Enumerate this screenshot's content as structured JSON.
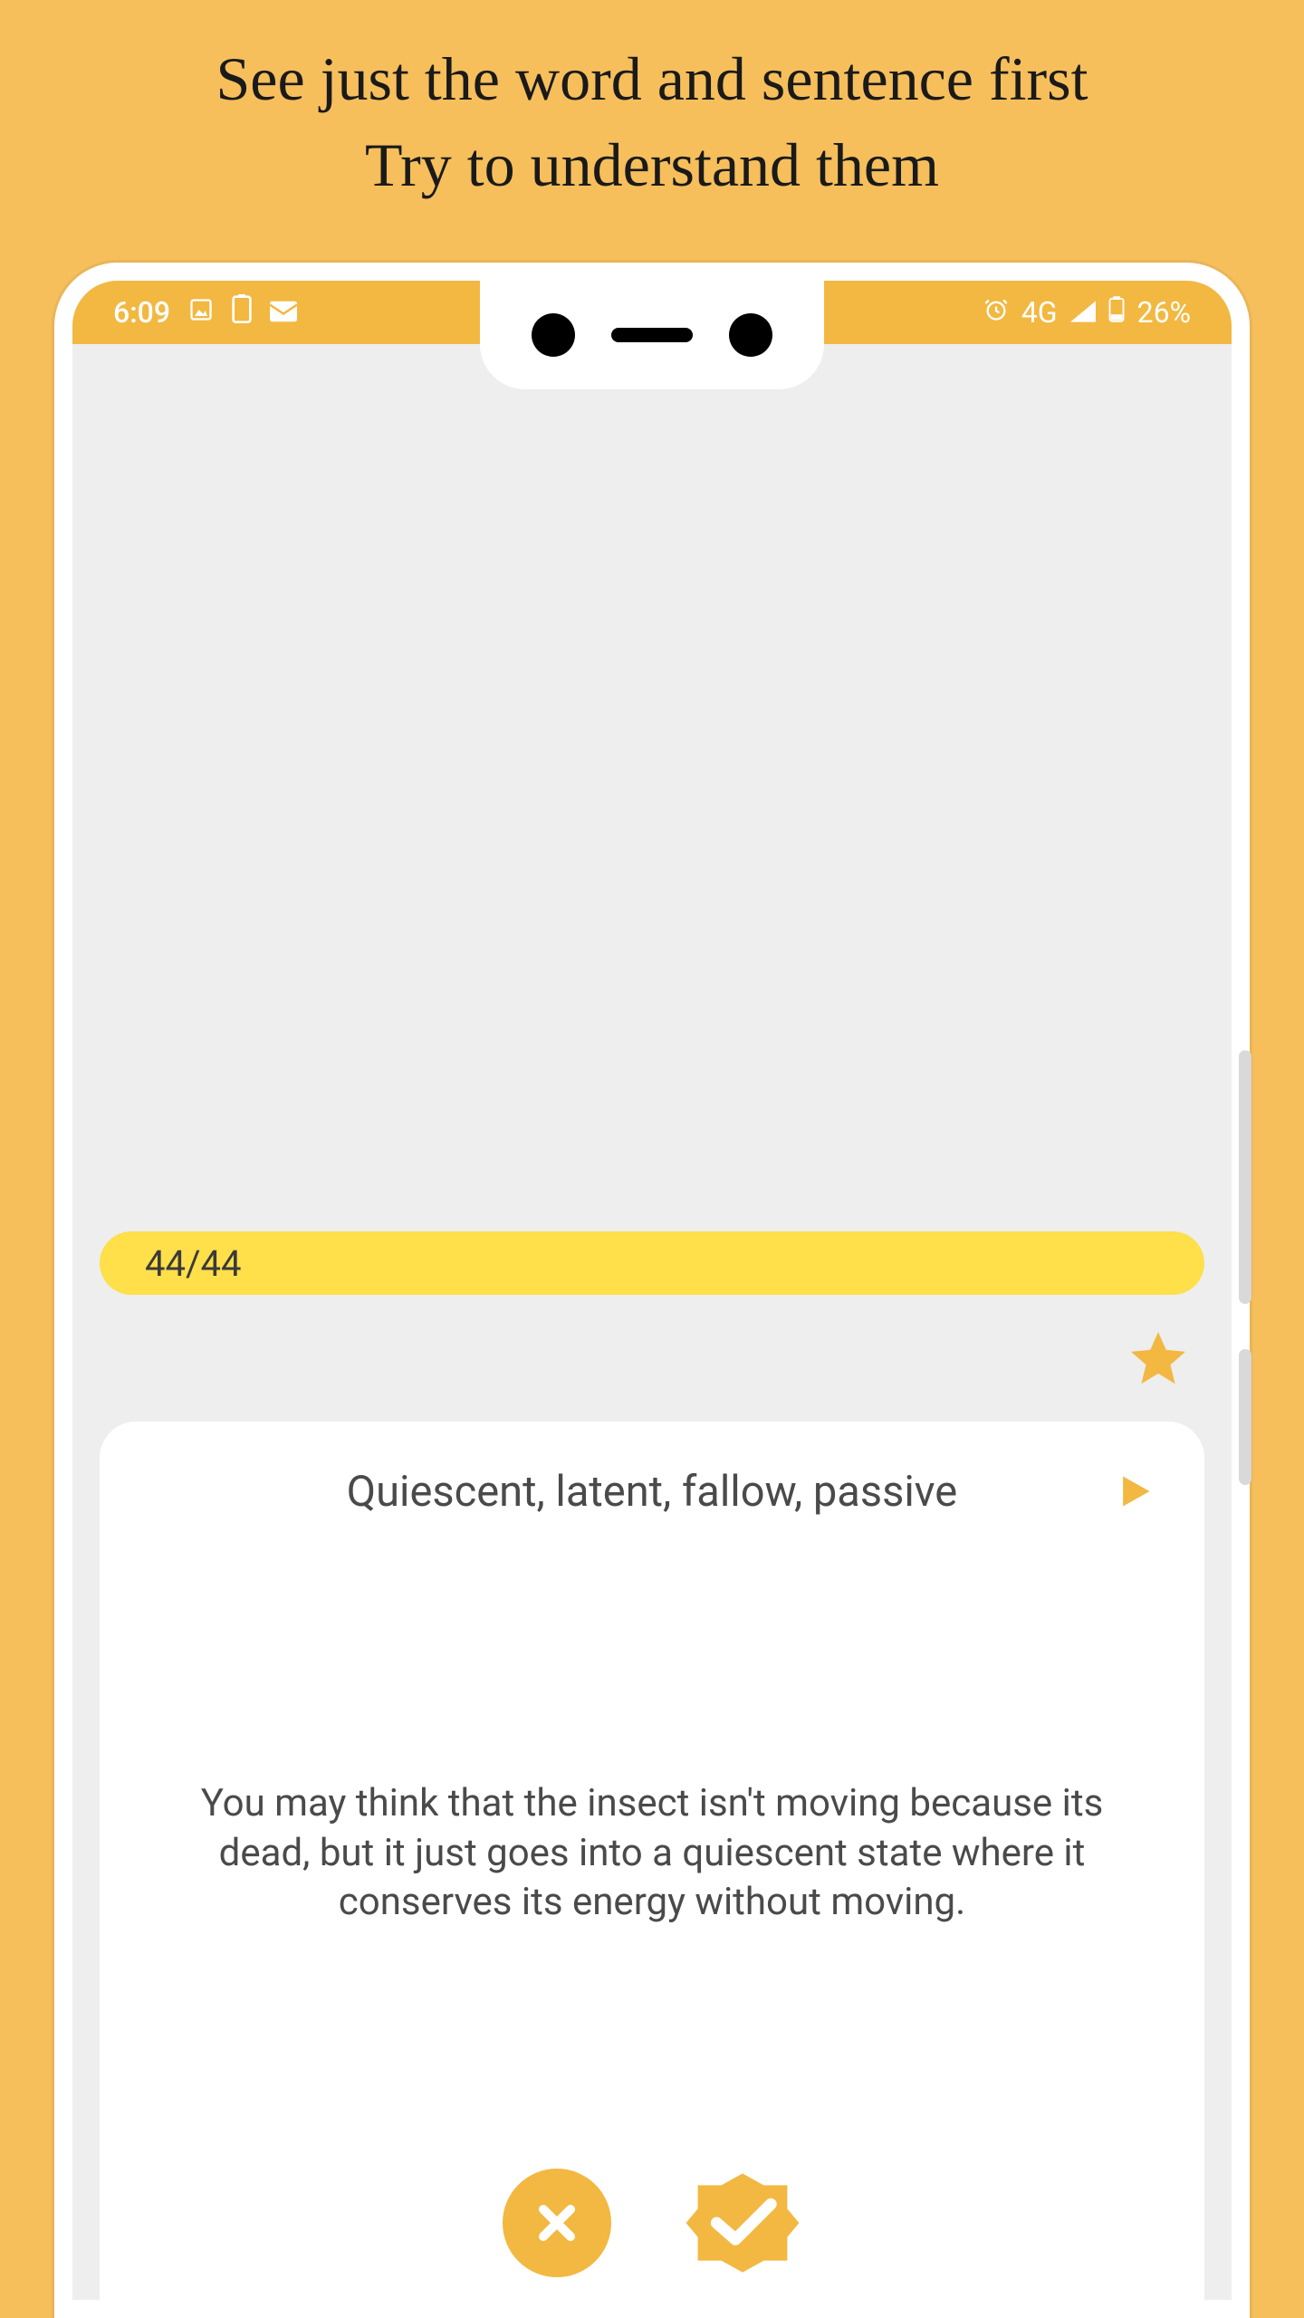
{
  "header": {
    "line1": "See just the word and sentence first",
    "line2": "Try to understand them"
  },
  "statusBar": {
    "time": "6:09",
    "network": "4G",
    "battery": "26%"
  },
  "progress": {
    "text": "44/44"
  },
  "card": {
    "word": "Quiescent, latent, fallow, passive",
    "sentence": "You may think that the insect isn't moving because its dead, but it just goes into a quiescent state where it conserves its energy without moving."
  },
  "colors": {
    "accent": "#f2b841",
    "yellow": "#ffdf4a",
    "background": "#f6bf5c"
  }
}
